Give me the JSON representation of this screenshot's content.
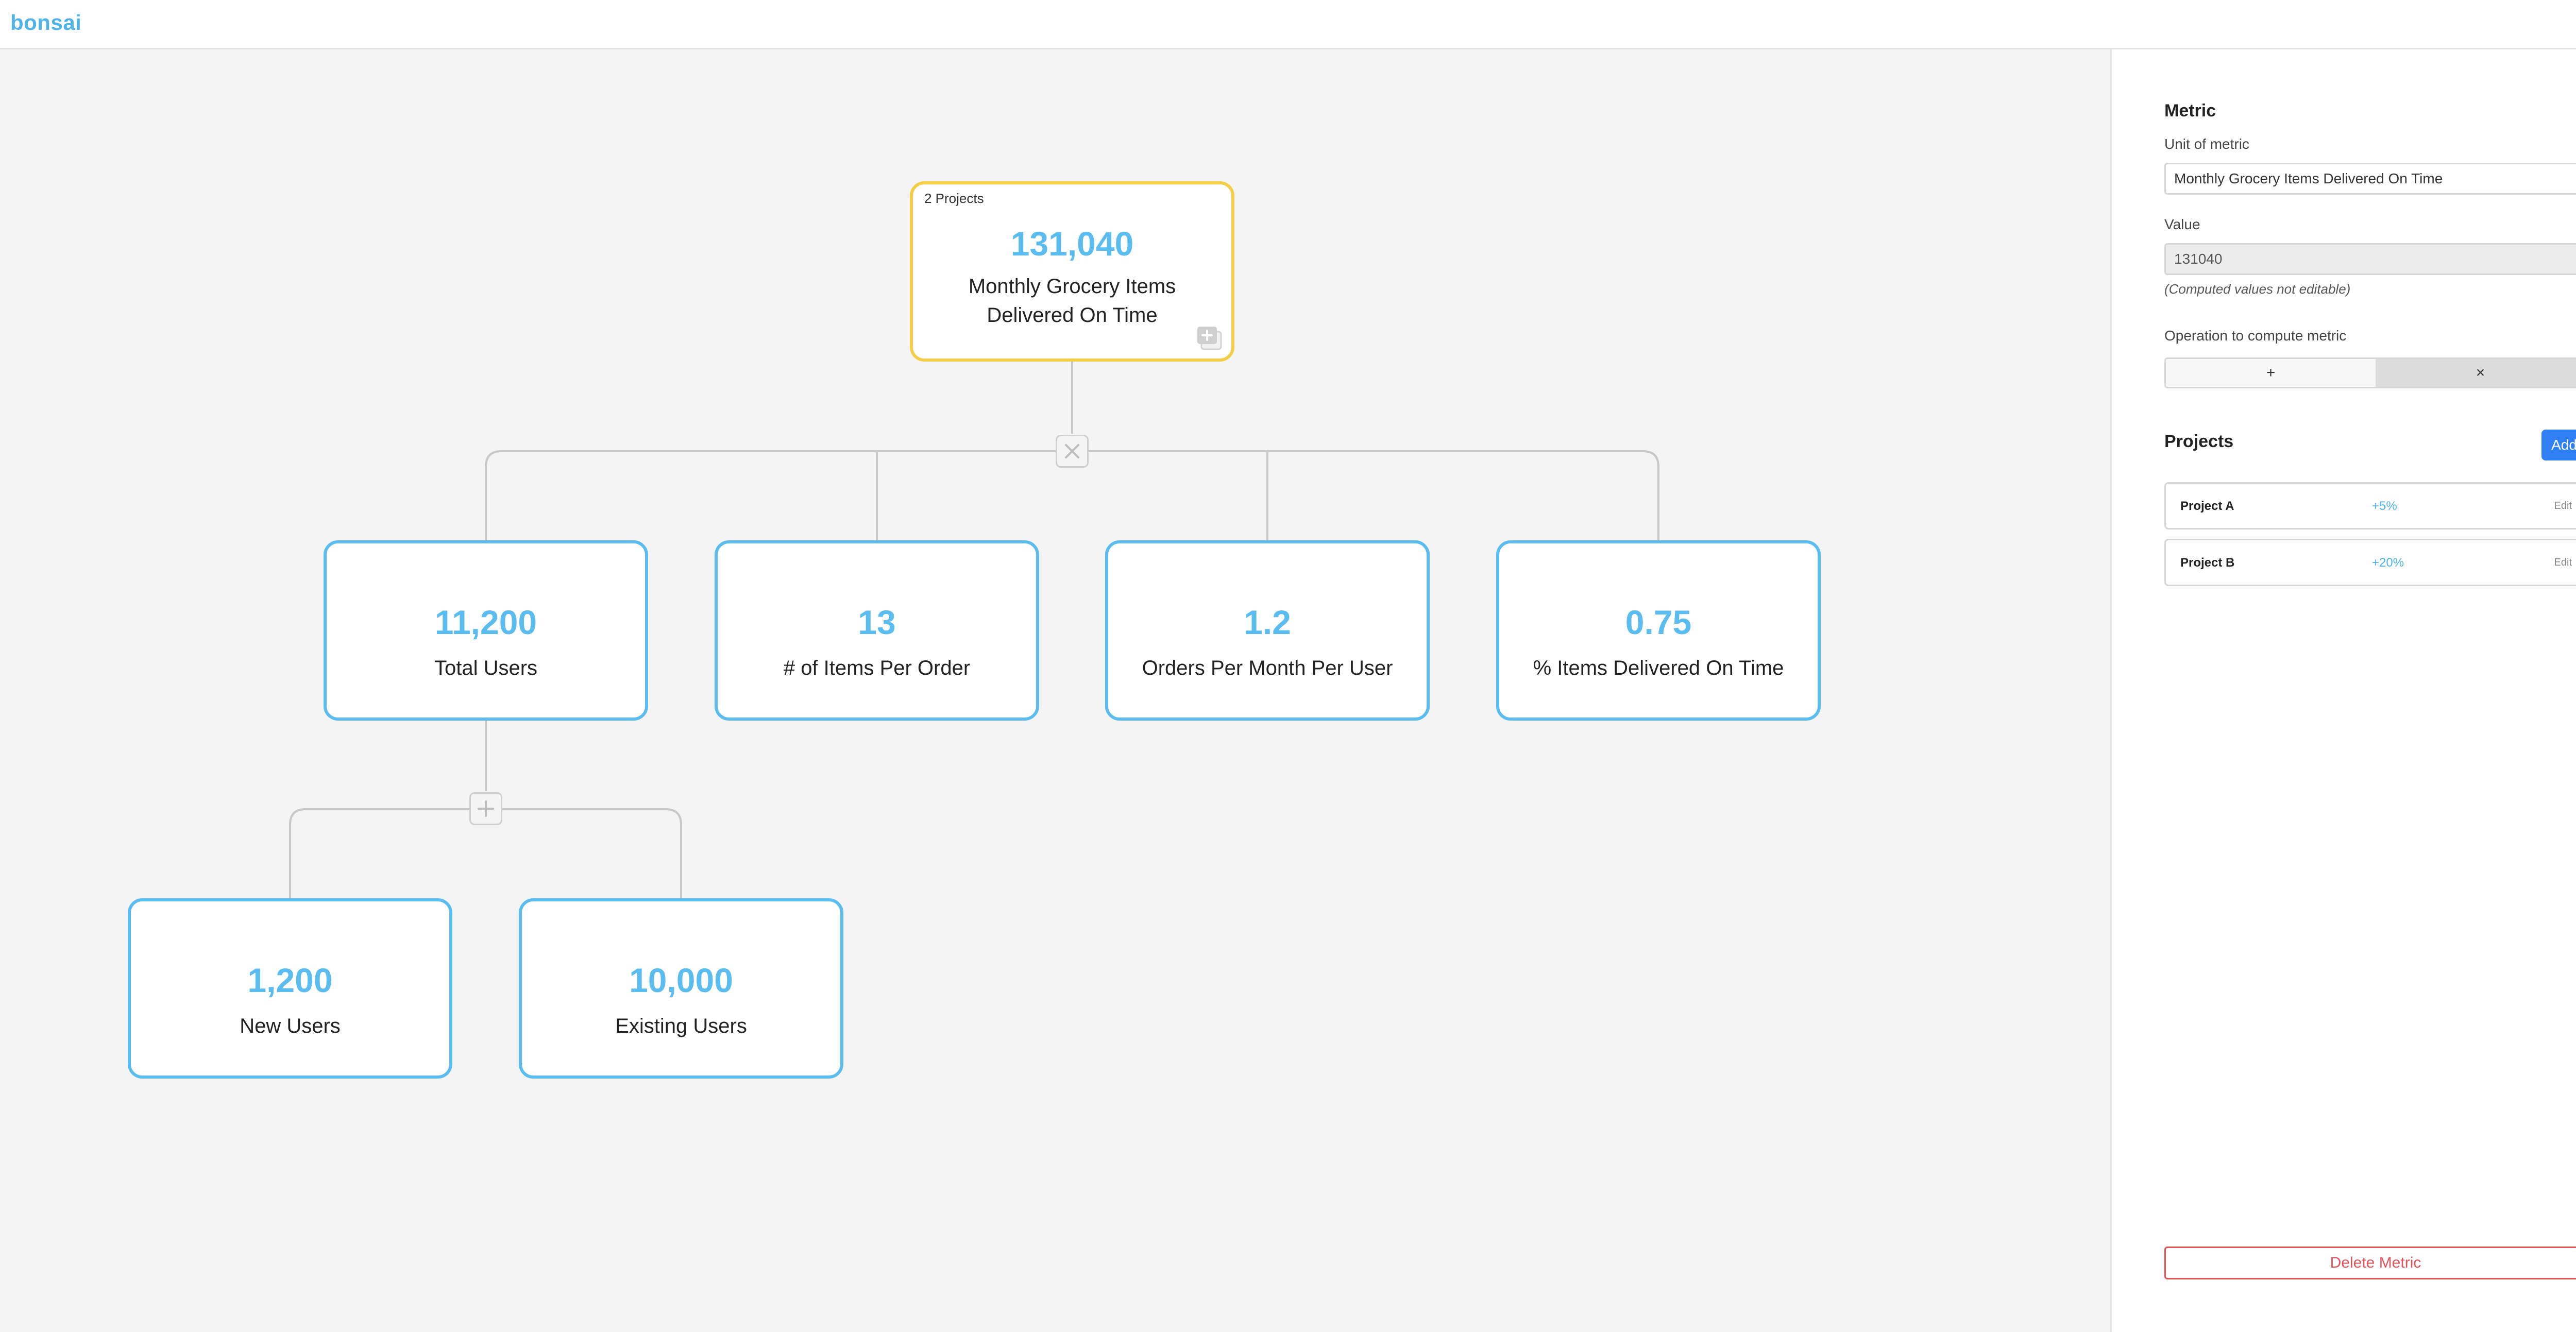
{
  "app": {
    "logo": "bonsai"
  },
  "colors": {
    "accent": "#5bbcf0",
    "selected_border": "#f3cd45",
    "primary_button": "#2f7ff5",
    "danger": "#e0545a"
  },
  "tree": {
    "root": {
      "projects_count": "2 Projects",
      "value": "131,040",
      "label": "Monthly Grocery Items Delivered On Time",
      "operation_icon": "multiply-icon"
    },
    "level1": [
      {
        "value": "11,200",
        "label": "Total Users"
      },
      {
        "value": "13",
        "label": "# of Items Per Order"
      },
      {
        "value": "1.2",
        "label": "Orders Per Month Per User"
      },
      {
        "value": "0.75",
        "label": "% Items Delivered On Time"
      }
    ],
    "total_users_operation_icon": "plus-icon",
    "level2": [
      {
        "value": "1,200",
        "label": "New Users"
      },
      {
        "value": "10,000",
        "label": "Existing Users"
      }
    ]
  },
  "panel": {
    "metric_title": "Metric",
    "unit_label": "Unit of metric",
    "unit_value": "Monthly Grocery Items Delivered On Time",
    "value_label": "Value",
    "value_value": "131040",
    "computed_note": "(Computed values not editable)",
    "operation_label": "Operation to compute metric",
    "operations": [
      "+",
      "×"
    ],
    "selected_operation": "×",
    "projects_title": "Projects",
    "add_label": "Add",
    "projects": [
      {
        "name": "Project A",
        "change": "+5%",
        "edit": "Edit"
      },
      {
        "name": "Project B",
        "change": "+20%",
        "edit": "Edit"
      }
    ],
    "delete_label": "Delete Metric"
  }
}
